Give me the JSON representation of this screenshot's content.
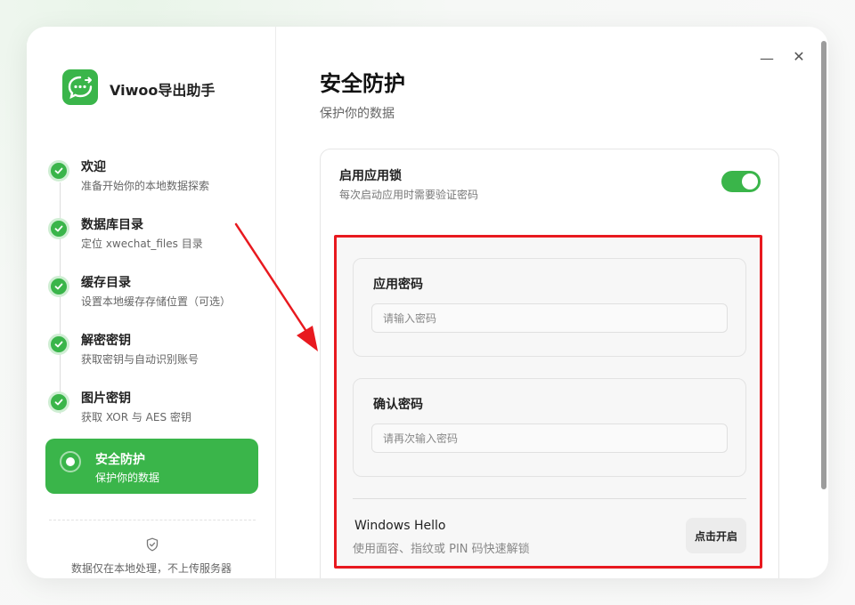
{
  "app": {
    "name": "Viwoo导出助手",
    "logo_icon": "chat-bubble-export-icon",
    "brand_color": "#3ab54a"
  },
  "sidebar": {
    "steps": [
      {
        "title": "欢迎",
        "subtitle": "准备开始你的本地数据探索",
        "status": "done"
      },
      {
        "title": "数据库目录",
        "subtitle": "定位 xwechat_files 目录",
        "status": "done"
      },
      {
        "title": "缓存目录",
        "subtitle": "设置本地缓存存储位置（可选）",
        "status": "done"
      },
      {
        "title": "解密密钥",
        "subtitle": "获取密钥与自动识别账号",
        "status": "done"
      },
      {
        "title": "图片密钥",
        "subtitle": "获取 XOR 与 AES 密钥",
        "status": "done"
      },
      {
        "title": "安全防护",
        "subtitle": "保护你的数据",
        "status": "active"
      }
    ],
    "privacy_note": "数据仅在本地处理，不上传服务器"
  },
  "window": {
    "minimize": "—",
    "close": "✕"
  },
  "main": {
    "title": "安全防护",
    "subtitle": "保护你的数据",
    "app_lock": {
      "title": "启用应用锁",
      "description": "每次启动应用时需要验证密码",
      "enabled": true
    },
    "password": {
      "label": "应用密码",
      "placeholder": "请输入密码",
      "value": ""
    },
    "confirm_password": {
      "label": "确认密码",
      "placeholder": "请再次输入密码",
      "value": ""
    },
    "windows_hello": {
      "title": "Windows Hello",
      "description": "使用面容、指纹或 PIN 码快速解锁",
      "button": "点击开启"
    }
  },
  "annotation": {
    "highlight_color": "#e8191f"
  }
}
